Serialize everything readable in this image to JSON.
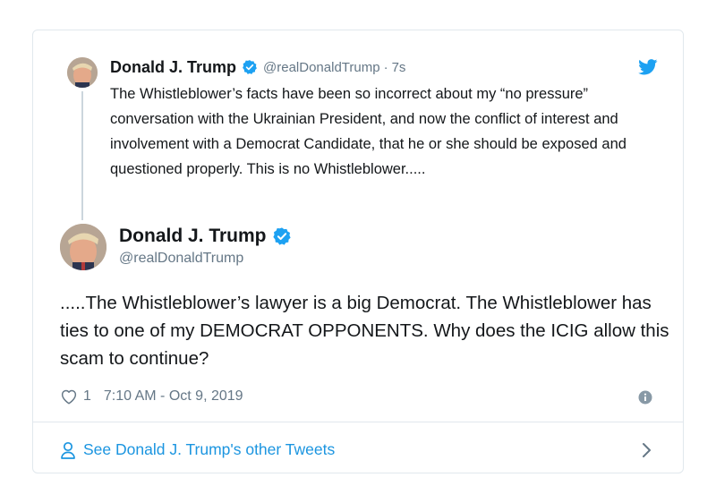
{
  "quoted_tweet": {
    "author_name": "Donald J. Trump",
    "handle": "@realDonaldTrump",
    "separator": "·",
    "time": "7s",
    "text": "The Whistleblower’s facts have been so incorrect about my “no pressure” conversation with the Ukrainian President, and now the conflict of interest and involvement with a Democrat Candidate, that he or she should be exposed and questioned properly. This is no Whistleblower....."
  },
  "main_tweet": {
    "author_name": "Donald J. Trump",
    "handle": "@realDonaldTrump",
    "text": ".....The Whistleblower’s lawyer is a big Democrat. The Whistleblower has ties to one of my DEMOCRAT OPPONENTS. Why does the ICIG allow this scam to continue?",
    "like_count": "1",
    "timestamp": "7:10 AM - Oct 9, 2019"
  },
  "footer": {
    "link_label": "See Donald J. Trump's other Tweets"
  },
  "icons": {
    "verified": "verified-badge-icon",
    "twitter": "twitter-bird-icon",
    "like": "heart-icon",
    "info": "info-icon",
    "user": "user-icon",
    "chevron": "chevron-right-icon"
  },
  "colors": {
    "accent": "#1da1f2",
    "link": "#1b95e0",
    "text": "#14171a",
    "muted": "#657786",
    "border": "#e1e8ed"
  }
}
